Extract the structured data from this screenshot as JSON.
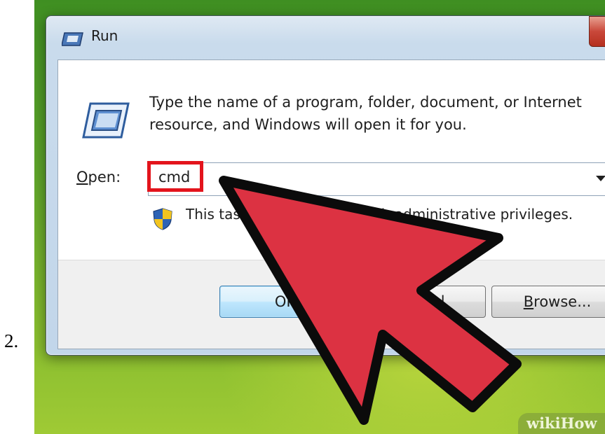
{
  "step": {
    "number": "2."
  },
  "window": {
    "title": "Run"
  },
  "dialog": {
    "description": "Type the name of a program, folder, document, or Internet resource, and Windows will open it for you.",
    "open_label_accel": "O",
    "open_label_rest": "pen:",
    "open_value": "cmd",
    "admin_note": "This task will be created with administrative privileges."
  },
  "buttons": {
    "ok": "OK",
    "cancel": "Cancel",
    "browse_accel": "B",
    "browse_rest": "rowse..."
  },
  "watermark": {
    "brand": "wikiHow"
  },
  "icons": {
    "window_icon": "run-window-icon",
    "dialog_icon": "run-program-icon",
    "shield": "uac-shield-icon",
    "pointer": "red-arrow-pointer"
  },
  "colors": {
    "highlight": "#e3141c",
    "arrow_fill": "#dc3242",
    "arrow_outline": "#0b0b0b",
    "desktop_green": "#5fa52a"
  }
}
